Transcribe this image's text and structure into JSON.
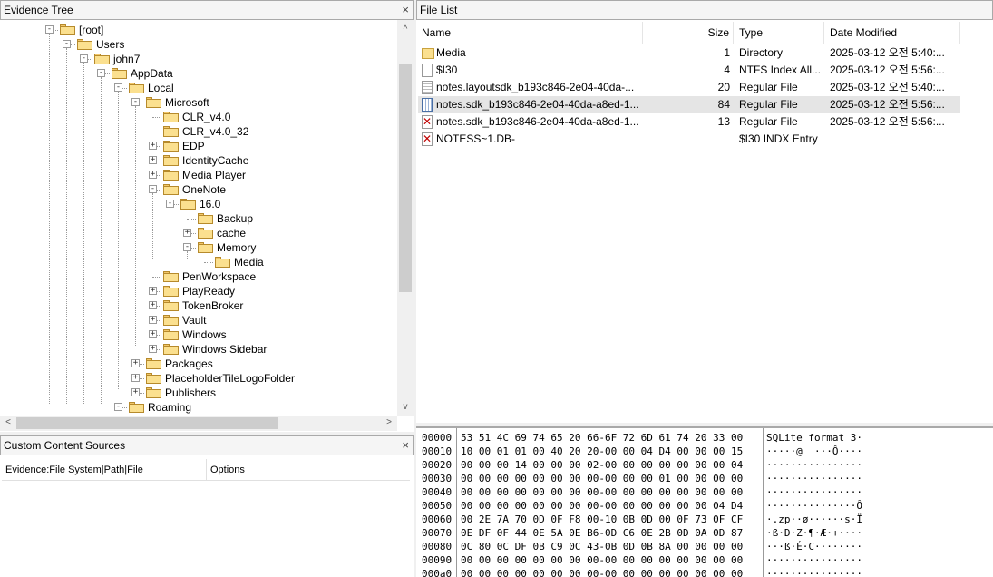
{
  "evidence_tree": {
    "title": "Evidence Tree",
    "close_glyph": "×",
    "nodes": [
      {
        "label": "[root]",
        "expander": "-"
      },
      {
        "label": "Users",
        "expander": "-"
      },
      {
        "label": "john7",
        "expander": "-"
      },
      {
        "label": "AppData",
        "expander": "-"
      },
      {
        "label": "Local",
        "expander": "-"
      },
      {
        "label": "Microsoft",
        "expander": "-"
      },
      {
        "label": "CLR_v4.0",
        "expander": ""
      },
      {
        "label": "CLR_v4.0_32",
        "expander": ""
      },
      {
        "label": "EDP",
        "expander": "+"
      },
      {
        "label": "IdentityCache",
        "expander": "+"
      },
      {
        "label": "Media Player",
        "expander": "+"
      },
      {
        "label": "OneNote",
        "expander": "-"
      },
      {
        "label": "16.0",
        "expander": "-"
      },
      {
        "label": "Backup",
        "expander": ""
      },
      {
        "label": "cache",
        "expander": "+"
      },
      {
        "label": "Memory",
        "expander": "-"
      },
      {
        "label": "Media",
        "expander": ""
      },
      {
        "label": "PenWorkspace",
        "expander": ""
      },
      {
        "label": "PlayReady",
        "expander": "+"
      },
      {
        "label": "TokenBroker",
        "expander": "+"
      },
      {
        "label": "Vault",
        "expander": "+"
      },
      {
        "label": "Windows",
        "expander": "+"
      },
      {
        "label": "Windows Sidebar",
        "expander": "+"
      },
      {
        "label": "Packages",
        "expander": "+"
      },
      {
        "label": "PlaceholderTileLogoFolder",
        "expander": "+"
      },
      {
        "label": "Publishers",
        "expander": "+"
      },
      {
        "label": "Roaming",
        "expander": "-"
      }
    ],
    "scroll_left_glyph": "<",
    "scroll_right_glyph": ">",
    "scroll_up_glyph": "^",
    "scroll_down_glyph": "v"
  },
  "custom_content": {
    "title": "Custom Content Sources",
    "close_glyph": "×",
    "columns": [
      "Evidence:File System|Path|File",
      "Options"
    ]
  },
  "file_list": {
    "title": "File List",
    "columns": {
      "name": "Name",
      "size": "Size",
      "type": "Type",
      "date": "Date Modified"
    },
    "rows": [
      {
        "icon": "folder-icon",
        "name": "Media",
        "size": "1",
        "type": "Directory",
        "date": "2025-03-12 오전 5:40:...",
        "selected": false
      },
      {
        "icon": "file-icon",
        "name": "$I30",
        "size": "4",
        "type": "NTFS Index All...",
        "date": "2025-03-12 오전 5:56:...",
        "selected": false
      },
      {
        "icon": "text-file-icon",
        "name": "notes.layoutsdk_b193c846-2e04-40da-...",
        "size": "20",
        "type": "Regular File",
        "date": "2025-03-12 오전 5:40:...",
        "selected": false
      },
      {
        "icon": "binary-file-icon",
        "name": "notes.sdk_b193c846-2e04-40da-a8ed-1...",
        "size": "84",
        "type": "Regular File",
        "date": "2025-03-12 오전 5:56:...",
        "selected": true
      },
      {
        "icon": "deleted-file-icon",
        "name": "notes.sdk_b193c846-2e04-40da-a8ed-1...",
        "size": "13",
        "type": "Regular File",
        "date": "2025-03-12 오전 5:56:...",
        "selected": false
      },
      {
        "icon": "deleted-file-icon",
        "name": "NOTESS~1.DB-",
        "size": "",
        "type": "$I30 INDX Entry",
        "date": "",
        "selected": false
      }
    ]
  },
  "hex_view": {
    "lines": [
      {
        "offset": "00000",
        "bytes": "53 51 4C 69 74 65 20 66-6F 72 6D 61 74 20 33 00",
        "ascii": "SQLite format 3·"
      },
      {
        "offset": "00010",
        "bytes": "10 00 01 01 00 40 20 20-00 00 04 D4 00 00 00 15",
        "ascii": "·····@  ···Ô····"
      },
      {
        "offset": "00020",
        "bytes": "00 00 00 14 00 00 00 02-00 00 00 00 00 00 00 04",
        "ascii": "················"
      },
      {
        "offset": "00030",
        "bytes": "00 00 00 00 00 00 00 00-00 00 00 01 00 00 00 00",
        "ascii": "················"
      },
      {
        "offset": "00040",
        "bytes": "00 00 00 00 00 00 00 00-00 00 00 00 00 00 00 00",
        "ascii": "················"
      },
      {
        "offset": "00050",
        "bytes": "00 00 00 00 00 00 00 00-00 00 00 00 00 00 04 D4",
        "ascii": "···············Ô"
      },
      {
        "offset": "00060",
        "bytes": "00 2E 7A 70 0D 0F F8 00-10 0B 0D 00 0F 73 0F CF",
        "ascii": "·.zp··ø······s·Ï"
      },
      {
        "offset": "00070",
        "bytes": "0E DF 0F 44 0E 5A 0E B6-0D C6 0E 2B 0D 0A 0D 87",
        "ascii": "·ß·D·Z·¶·Æ·+····"
      },
      {
        "offset": "00080",
        "bytes": "0C 80 0C DF 0B C9 0C 43-0B 0D 0B 8A 00 00 00 00",
        "ascii": "···ß·É·C········"
      },
      {
        "offset": "00090",
        "bytes": "00 00 00 00 00 00 00 00-00 00 00 00 00 00 00 00",
        "ascii": "················"
      },
      {
        "offset": "000a0",
        "bytes": "00 00 00 00 00 00 00 00-00 00 00 00 00 00 00 00",
        "ascii": "················"
      }
    ]
  }
}
